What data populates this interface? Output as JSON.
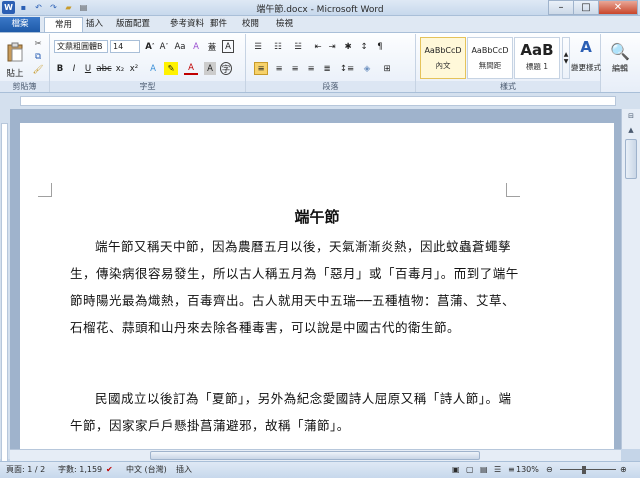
{
  "window": {
    "title": "端午節.docx - Microsoft Word"
  },
  "qat_icons": [
    "word-logo-icon",
    "save-icon",
    "undo-icon",
    "redo-icon",
    "open-icon",
    "print-icon"
  ],
  "tabs": [
    "檔案",
    "常用",
    "插入",
    "版面配置",
    "參考資料",
    "郵件",
    "校閱",
    "檢視"
  ],
  "ribbon": {
    "clipboard": {
      "paste": "貼上",
      "label": "剪貼簿"
    },
    "font": {
      "name": "文鼎粗圓體B",
      "size": "14",
      "label": "字型"
    },
    "paragraph": {
      "label": "段落"
    },
    "styles": {
      "items": [
        {
          "sample": "AaBbCcD",
          "name": "內文"
        },
        {
          "sample": "AaBbCcD",
          "name": "無間距"
        },
        {
          "sample": "AaB",
          "name": "標題 1"
        }
      ],
      "change": "變更樣式",
      "label": "樣式"
    },
    "editing": {
      "label": "編輯"
    }
  },
  "document": {
    "title": "端午節",
    "paragraphs": [
      "端午節又稱天中節，因為農曆五月以後，天氣漸漸炎熱，因此蚊蟲蒼蠅孳生，傳染病很容易發生，所以古人稱五月為「惡月」或「百毒月」。而到了端午節時陽光最為熾熱，百毒齊出。古人就用天中五瑞──五種植物：菖蒲、艾草、石榴花、蒜頭和山丹來去除各種毒害，可以說是中國古代的衛生節。",
      "民國成立以後訂為「夏節」，另外為紀念愛國詩人屈原又稱「詩人節」。端午節，因家家戶戶懸掛菖蒲避邪，故稱「蒲節」。"
    ]
  },
  "statusbar": {
    "page": "頁面: 1 / 2",
    "words": "字數: 1,159",
    "language": "中文 (台灣)",
    "mode": "插入",
    "zoom": "130%"
  }
}
